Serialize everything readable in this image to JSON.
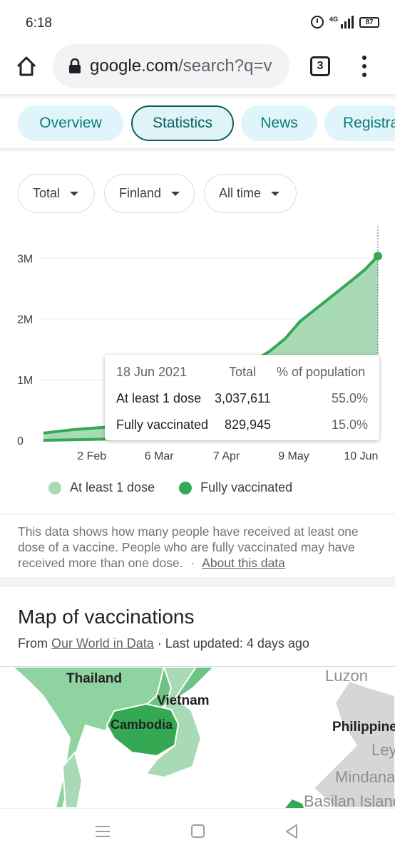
{
  "status_bar": {
    "time": "6:18",
    "network": "4G",
    "battery": "87"
  },
  "browser": {
    "url_host": "google.com",
    "url_rest": "/search?q=v",
    "tab_count": "3"
  },
  "tabs": [
    "Overview",
    "Statistics",
    "News",
    "Registra"
  ],
  "active_tab": "Statistics",
  "filters": [
    "Total",
    "Finland",
    "All time"
  ],
  "chart_data": {
    "type": "area",
    "y_ticks": [
      "3M",
      "2M",
      "1M",
      "0"
    ],
    "x_ticks": [
      "2 Feb",
      "6 Mar",
      "7 Apr",
      "9 May",
      "10 Jun"
    ],
    "ylim": [
      0,
      3500000
    ],
    "series": [
      {
        "name": "At least 1 dose",
        "color": "#a8dab5",
        "points": [
          [
            "2021-01-10",
            120000
          ],
          [
            "2021-01-25",
            180000
          ],
          [
            "2021-02-10",
            220000
          ],
          [
            "2021-02-25",
            300000
          ],
          [
            "2021-03-10",
            420000
          ],
          [
            "2021-03-25",
            600000
          ],
          [
            "2021-04-10",
            900000
          ],
          [
            "2021-04-20",
            1300000
          ],
          [
            "2021-04-28",
            1480000
          ],
          [
            "2021-05-05",
            1680000
          ],
          [
            "2021-05-12",
            1960000
          ],
          [
            "2021-05-20",
            2180000
          ],
          [
            "2021-05-28",
            2400000
          ],
          [
            "2021-06-05",
            2620000
          ],
          [
            "2021-06-12",
            2820000
          ],
          [
            "2021-06-18",
            3037611
          ]
        ]
      },
      {
        "name": "Fully vaccinated",
        "color": "#34a853",
        "points": [
          [
            "2021-01-10",
            0
          ],
          [
            "2021-02-10",
            20000
          ],
          [
            "2021-03-10",
            60000
          ],
          [
            "2021-04-10",
            100000
          ],
          [
            "2021-05-10",
            200000
          ],
          [
            "2021-06-01",
            500000
          ],
          [
            "2021-06-18",
            829945
          ]
        ]
      }
    ],
    "tooltip": {
      "date": "18 Jun 2021",
      "col_total": "Total",
      "col_pct": "% of population",
      "rows": [
        {
          "label": "At least 1 dose",
          "total": "3,037,611",
          "pct": "55.0%"
        },
        {
          "label": "Fully vaccinated",
          "total": "829,945",
          "pct": "15.0%"
        }
      ]
    }
  },
  "legend": [
    {
      "label": "At least 1 dose",
      "color": "#a8dab5"
    },
    {
      "label": "Fully vaccinated",
      "color": "#34a853"
    }
  ],
  "note": {
    "text": "This data shows how many people have received at least one dose of a vaccine. People who are fully vaccinated may have received more than one dose.",
    "separator": "·",
    "link": "About this data"
  },
  "map_section": {
    "title": "Map of vaccinations",
    "from_prefix": "From",
    "source": "Our World in Data",
    "updated": "· Last updated: 4 days ago",
    "labels": [
      "Thailand",
      "Vietnam",
      "Cambodia",
      "Luzon",
      "Philippines",
      "Leyte",
      "Mindanao",
      "Basilan Island"
    ]
  }
}
